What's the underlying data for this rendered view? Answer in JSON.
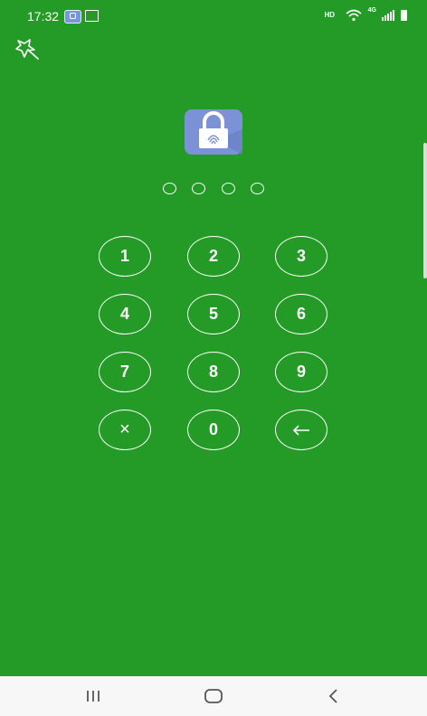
{
  "status_bar": {
    "time": "17:32",
    "network_quality": "HD",
    "network_type": "4G"
  },
  "icons": {
    "theme": "magic-wand-star-icon",
    "app_lock": "padlock-fingerprint-icon",
    "backspace": "arrow-left-icon",
    "nav_recents": "recents-icon",
    "nav_home": "home-icon",
    "nav_back": "back-icon"
  },
  "pin": {
    "length": 4,
    "entered": 0
  },
  "keypad": {
    "keys": [
      "1",
      "2",
      "3",
      "4",
      "5",
      "6",
      "7",
      "8",
      "9",
      "×",
      "0",
      "←"
    ]
  },
  "colors": {
    "background": "#259b27",
    "app_icon": "#7b92d6",
    "nav_bar": "#f7f7f7"
  }
}
